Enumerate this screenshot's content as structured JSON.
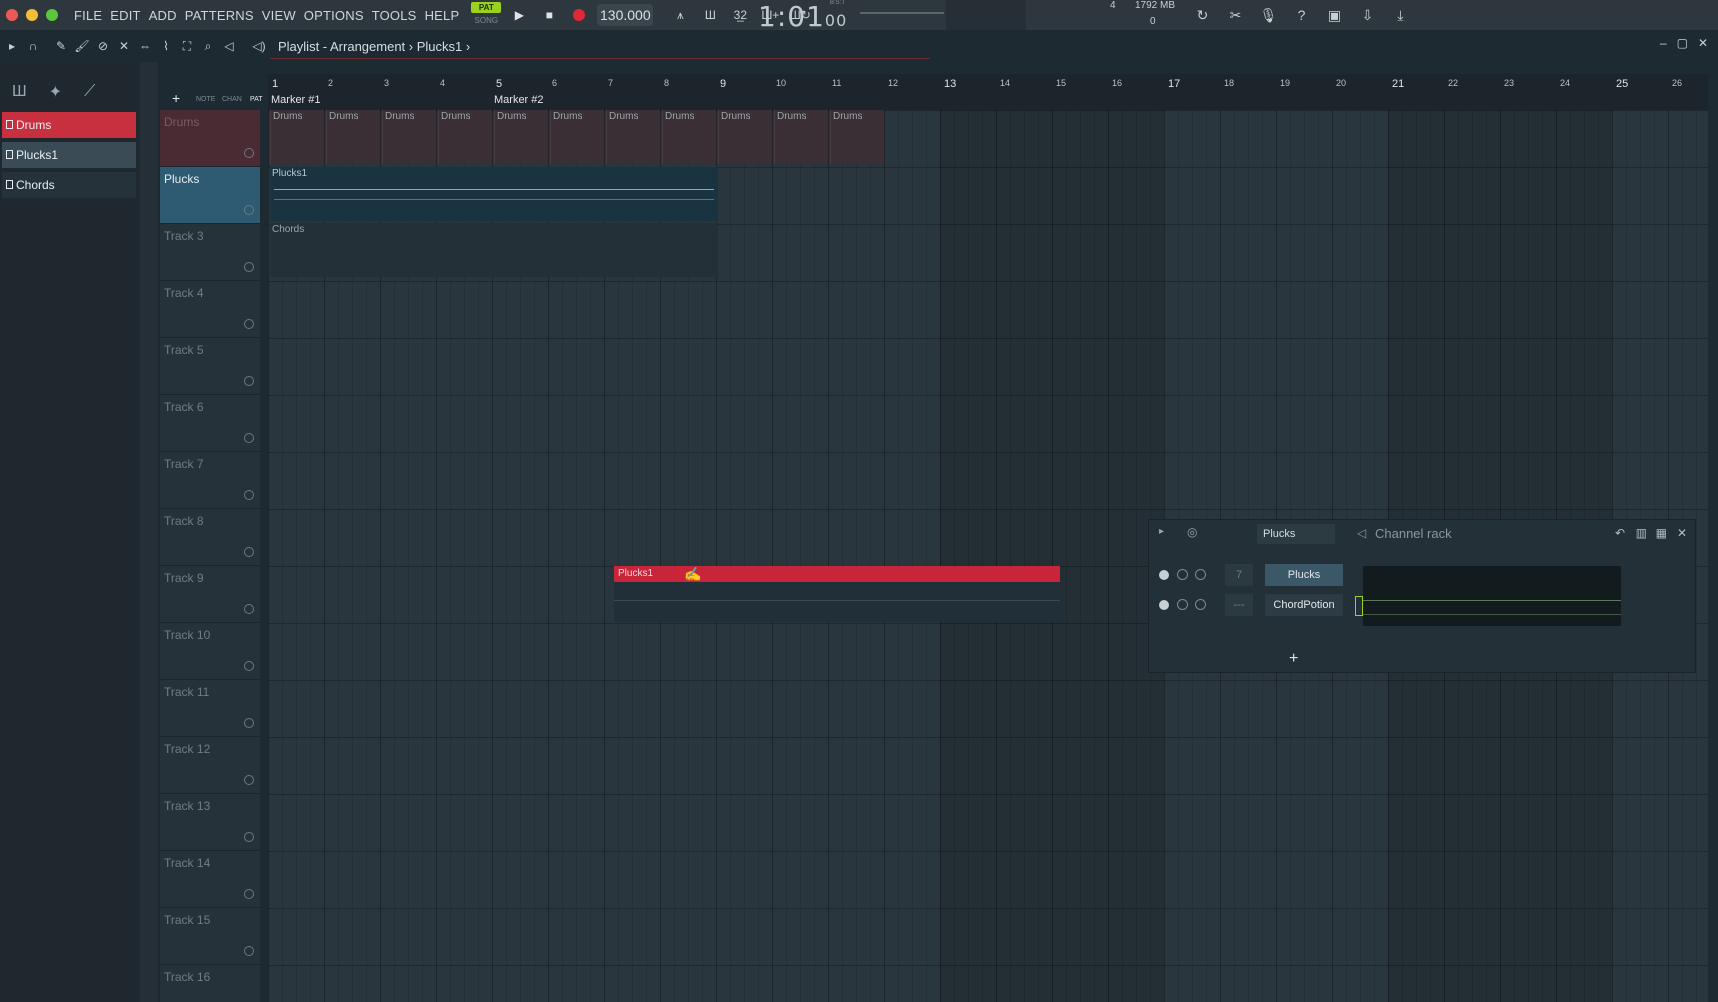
{
  "menu": [
    "FILE",
    "EDIT",
    "ADD",
    "PATTERNS",
    "VIEW",
    "OPTIONS",
    "TOOLS",
    "HELP"
  ],
  "transport": {
    "pat": "PAT",
    "song": "SONG",
    "tempo": "130.000",
    "time": "1:01",
    "time_sub": "00",
    "bst": "B:S:T"
  },
  "meters": {
    "memory": "1792 MB",
    "cpu": "4",
    "poly": "0"
  },
  "playlist": {
    "title": "Playlist - Arrangement",
    "pattern": "Plucks1"
  },
  "picker": {
    "items": [
      {
        "label": "Drums"
      },
      {
        "label": "Plucks1"
      },
      {
        "label": "Chords"
      }
    ]
  },
  "trackhdr": {
    "note": "NOTE",
    "chan": "CHAN",
    "pat": "PAT"
  },
  "tracks": [
    {
      "name": "Drums"
    },
    {
      "name": "Plucks"
    },
    {
      "name": "Track 3"
    },
    {
      "name": "Track 4"
    },
    {
      "name": "Track 5"
    },
    {
      "name": "Track 6"
    },
    {
      "name": "Track 7"
    },
    {
      "name": "Track 8"
    },
    {
      "name": "Track 9"
    },
    {
      "name": "Track 10"
    },
    {
      "name": "Track 11"
    },
    {
      "name": "Track 12"
    },
    {
      "name": "Track 13"
    },
    {
      "name": "Track 14"
    },
    {
      "name": "Track 15"
    },
    {
      "name": "Track 16"
    }
  ],
  "ruler": {
    "bars": [
      "1",
      "2",
      "3",
      "4",
      "5",
      "6",
      "7",
      "8",
      "9",
      "10",
      "11",
      "12",
      "13",
      "14",
      "15",
      "16",
      "17",
      "18",
      "19",
      "20",
      "21",
      "22",
      "23",
      "24",
      "25",
      "26"
    ],
    "markers": [
      "Marker #1",
      "Marker #2"
    ]
  },
  "clips": {
    "drums": "Drums",
    "plucks": "Plucks1",
    "chords": "Chords",
    "floating": "Plucks1"
  },
  "channel_rack": {
    "title": "Channel rack",
    "selector": "Plucks",
    "rows": [
      {
        "num": "7",
        "name": "Plucks"
      },
      {
        "num": "---",
        "name": "ChordPotion"
      }
    ]
  },
  "colors": {
    "accent": "#9bd21e",
    "record": "#e0283a",
    "clip_red": "#c8253a",
    "bg": "#1e2a32"
  }
}
